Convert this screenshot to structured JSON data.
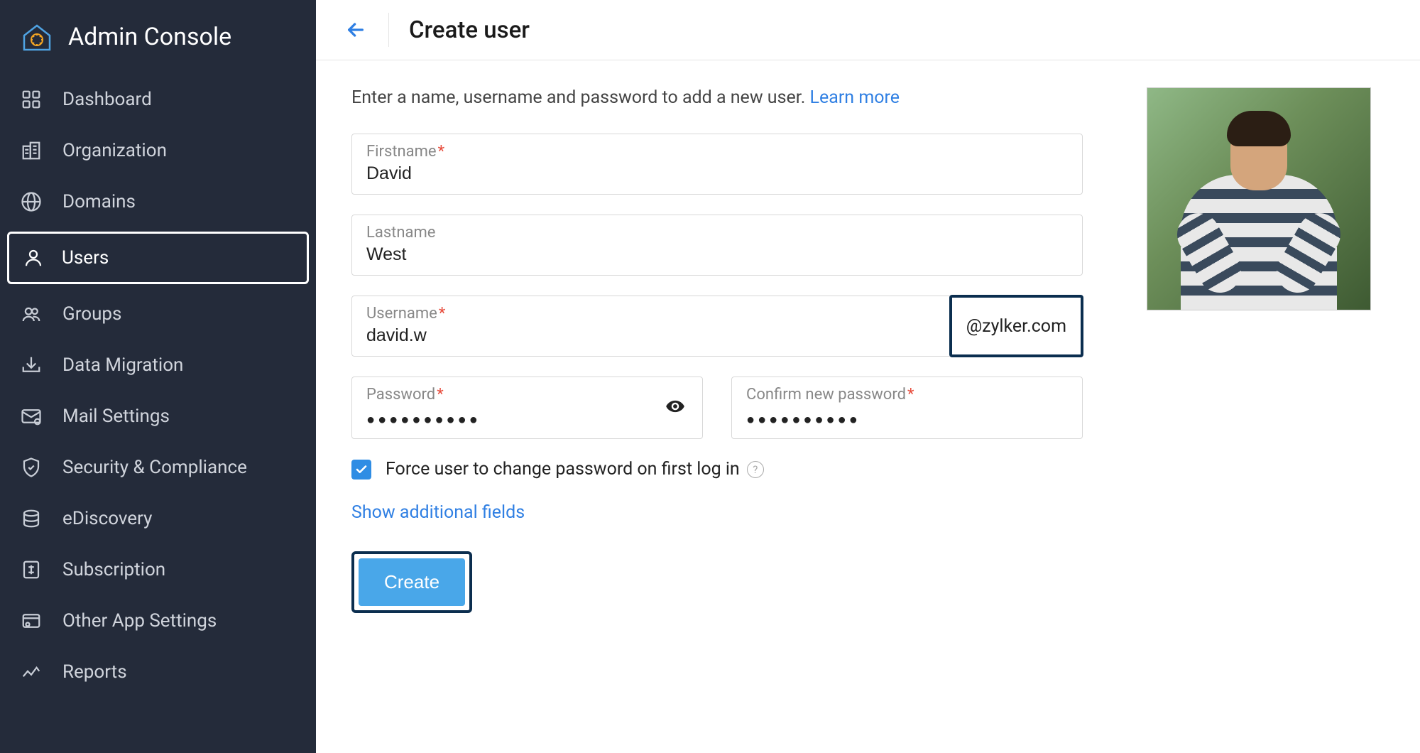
{
  "sidebar": {
    "title": "Admin Console",
    "items": [
      {
        "label": "Dashboard"
      },
      {
        "label": "Organization"
      },
      {
        "label": "Domains"
      },
      {
        "label": "Users"
      },
      {
        "label": "Groups"
      },
      {
        "label": "Data Migration"
      },
      {
        "label": "Mail Settings"
      },
      {
        "label": "Security & Compliance"
      },
      {
        "label": "eDiscovery"
      },
      {
        "label": "Subscription"
      },
      {
        "label": "Other App Settings"
      },
      {
        "label": "Reports"
      }
    ]
  },
  "header": {
    "title": "Create user"
  },
  "form": {
    "intro": "Enter a name, username and password to add a new user.  ",
    "learn_more": "Learn more",
    "firstname_label": "Firstname",
    "firstname_value": "David",
    "lastname_label": "Lastname",
    "lastname_value": "West",
    "username_label": "Username",
    "username_value": "david.w",
    "domain": "@zylker.com",
    "password_label": "Password",
    "password_dots": "●●●●●●●●●●",
    "confirm_label": "Confirm new password",
    "confirm_dots": "●●●●●●●●●●",
    "force_change_label": "Force user to change password on first log in",
    "additional_link": "Show additional fields",
    "create_label": "Create"
  }
}
